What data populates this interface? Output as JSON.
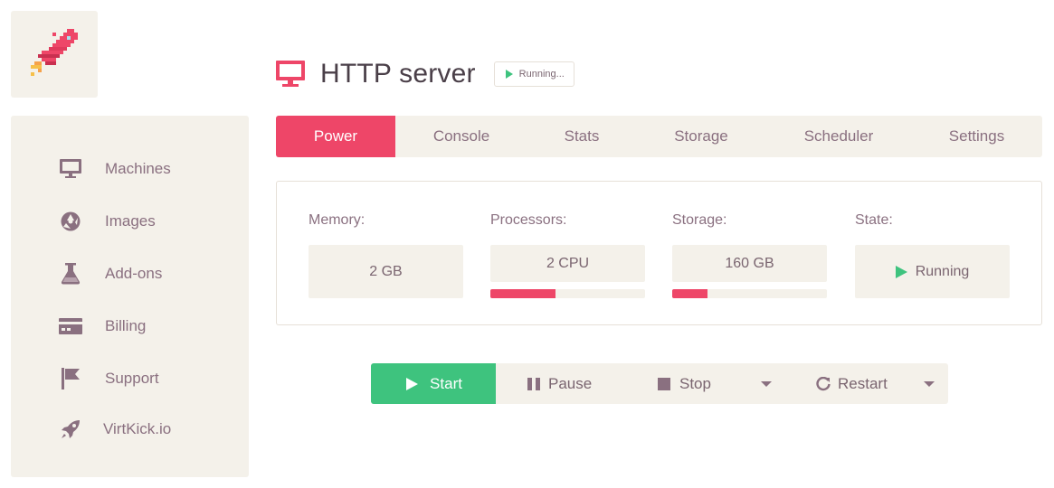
{
  "sidebar": {
    "items": [
      {
        "label": "Machines",
        "icon": "monitor-icon"
      },
      {
        "label": "Images",
        "icon": "aperture-icon"
      },
      {
        "label": "Add-ons",
        "icon": "flask-icon"
      },
      {
        "label": "Billing",
        "icon": "credit-card-icon"
      },
      {
        "label": "Support",
        "icon": "flag-icon"
      },
      {
        "label": "VirtKick.io",
        "icon": "rocket-icon"
      }
    ]
  },
  "header": {
    "title": "HTTP server",
    "status": "Running..."
  },
  "tabs": [
    "Power",
    "Console",
    "Stats",
    "Storage",
    "Scheduler",
    "Settings"
  ],
  "active_tab": "Power",
  "info": {
    "memory": {
      "label": "Memory:",
      "value": "2 GB"
    },
    "processors": {
      "label": "Processors:",
      "value": "2 CPU",
      "usage_fraction": 0.42
    },
    "storage": {
      "label": "Storage:",
      "value": "160 GB",
      "usage_fraction": 0.23
    },
    "state": {
      "label": "State:",
      "value": "Running"
    }
  },
  "actions": {
    "start": "Start",
    "pause": "Pause",
    "stop": "Stop",
    "restart": "Restart"
  },
  "colors": {
    "accent": "#ee4668",
    "success": "#3ec37e",
    "panel_bg": "#f4f1ea",
    "text": "#8a7080",
    "title": "#4a3f48"
  }
}
